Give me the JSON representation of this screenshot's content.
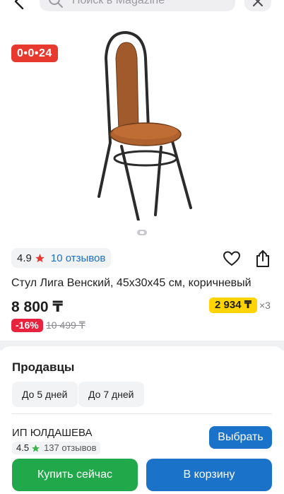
{
  "header": {
    "search_placeholder": "Поиск в Magazine",
    "icons": {
      "back": "back-arrow-icon",
      "search": "search-icon",
      "close": "close-icon"
    }
  },
  "product": {
    "timer_badge": "0•0•24",
    "rating": "4.9",
    "reviews_link": "10 отзывов",
    "title": "Стул Лига Венский, 45х30х45 см, коричневый",
    "price": "8 800 ₸",
    "installment_price": "2 934 ₸",
    "installment_multiplier": "×3",
    "discount": "-16%",
    "old_price": "10 499 ₸",
    "image_count": 1,
    "current_image": 1
  },
  "sellers": {
    "title": "Продавцы",
    "delivery_filters": [
      "До 5 дней",
      "До 7 дней"
    ],
    "seller": {
      "name": "ИП ЮЛДАШЕВА",
      "rating": "4.5",
      "reviews": "137 отзывов",
      "choose_label": "Выбрать"
    }
  },
  "actions": {
    "buy_now": "Купить сейчас",
    "add_to_cart": "В корзину"
  },
  "colors": {
    "timer_badge": "#e8392f",
    "installment": "#ffd400",
    "discount": "#e8233f",
    "primary_blue": "#1a73c9",
    "buy_green": "#21a84a",
    "rating_star": "#e8392f",
    "seller_star": "#3bb34a"
  }
}
